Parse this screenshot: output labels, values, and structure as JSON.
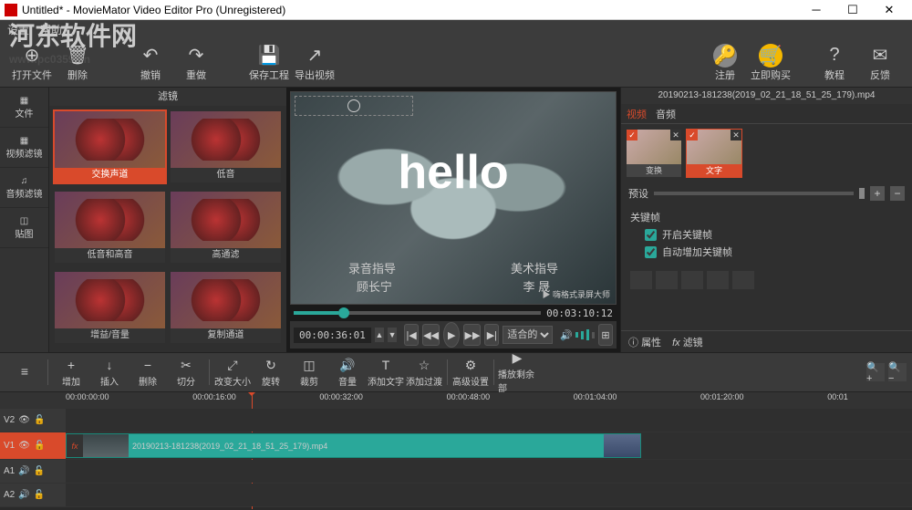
{
  "window": {
    "title": "Untitled* - MovieMator Video Editor Pro (Unregistered)"
  },
  "watermark": {
    "main": "河东软件网",
    "sub": "www.pc0359.cn"
  },
  "menu": {
    "file": "设置",
    "edit": "帮助"
  },
  "toolbar": {
    "open": "打开文件",
    "delete": "删除",
    "undo": "撤销",
    "redo": "重做",
    "save": "保存工程",
    "export": "导出视频",
    "register": "注册",
    "buy": "立即购买",
    "tutorial": "教程",
    "feedback": "反馈"
  },
  "leftnav": {
    "file": "文件",
    "vfilter": "视频滤镜",
    "afilter": "音频滤镜",
    "sticker": "贴图"
  },
  "filterpanel": {
    "title": "滤镜",
    "items": [
      "交换声道",
      "低音",
      "低音和高音",
      "高通滤",
      "增益/音量",
      "复制通道"
    ]
  },
  "preview": {
    "hello": "hello",
    "credit1a": "录音指导",
    "credit1b": "美术指导",
    "credit2a": "顾长宁",
    "credit2b": "李 晟",
    "wm_label": "嗨格式录屏大师",
    "timecode": "00:03:10:12",
    "pos": "00:00:36:01",
    "fit": "适合的"
  },
  "right": {
    "clipname": "20190213-181238(2019_02_21_18_51_25_179).mp4",
    "tab_video": "视频",
    "tab_audio": "音频",
    "fx1": "变换",
    "fx2": "文字",
    "preset_label": "预设",
    "keyframe_label": "关键帧",
    "kf_enable": "开启关键帧",
    "kf_auto": "自动增加关键帧",
    "prop": "属性",
    "filter": "滤镜"
  },
  "tltool": {
    "add": "增加",
    "insert": "插入",
    "del": "删除",
    "split": "切分",
    "resize": "改变大小",
    "rotate": "旋转",
    "crop": "裁剪",
    "volume": "音量",
    "text": "添加文字",
    "trans": "添加过渡",
    "more": "高级设置",
    "play": "播放剩余部"
  },
  "ruler": [
    "00:00:00:00",
    "00:00:16:00",
    "00:00:32:00",
    "00:00:48:00",
    "00:01:04:00",
    "00:01:20:00",
    "00:01"
  ],
  "tracks": {
    "v2": "V2",
    "v1": "V1",
    "a1": "A1",
    "a2": "A2",
    "clipname": "20190213-181238(2019_02_21_18_51_25_179).mp4"
  }
}
